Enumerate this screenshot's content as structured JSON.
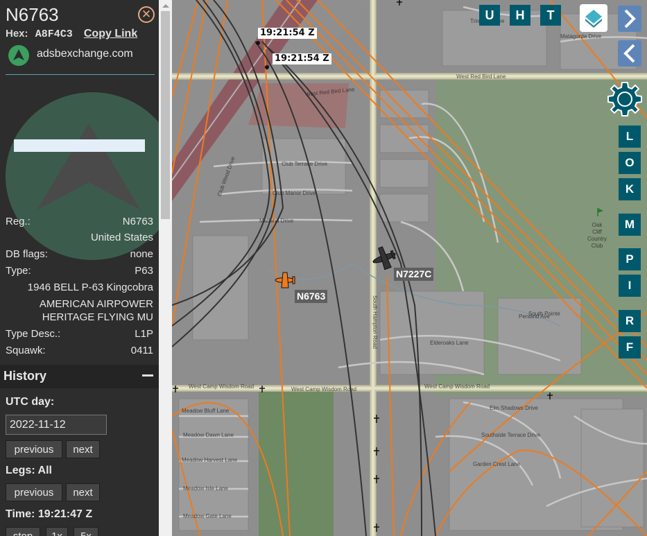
{
  "aircraft": {
    "title": "N6763",
    "hex_label": "Hex:",
    "hex_value": "A8F4C3",
    "copy_link": "Copy Link",
    "source": "adsbexchange.com",
    "reg_label": "Reg.:",
    "reg_value": "N6763",
    "country": "United States",
    "dbflags_label": "DB flags:",
    "dbflags_value": "none",
    "type_label": "Type:",
    "type_value": "P63",
    "model": "1946 BELL P-63 Kingcobra",
    "owner_line1": "AMERICAN AIRPOWER",
    "owner_line2": "HERITAGE FLYING MU",
    "typedesc_label": "Type Desc.:",
    "typedesc_value": "L1P",
    "squawk_label": "Squawk:",
    "squawk_value": "0411"
  },
  "history": {
    "header": "History",
    "utc_day_label": "UTC day:",
    "utc_day_value": "2022-11-12",
    "prev_label": "previous",
    "next_label": "next",
    "legs_label": "Legs: All",
    "legs_prev": "previous",
    "legs_next": "next",
    "time_label": "Time: 19:21:47 Z",
    "stop_label": "stop",
    "speed1_label": "1x",
    "speed5_label": "5x"
  },
  "map": {
    "timestamps": [
      "19:21:54 Z",
      "19:21:54 Z"
    ],
    "aircraft_labels": [
      "N6763",
      "N7227C"
    ],
    "top_buttons": [
      "U",
      "H",
      "T"
    ],
    "side_buttons": [
      "L",
      "O",
      "K",
      "M",
      "P",
      "I",
      "R",
      "F"
    ],
    "road_labels": {
      "west_red_bird_lane_1": "West Red Bird Lane",
      "west_red_bird_lane_2": "West Red Bird Lane",
      "club_terrace": "Club Terrace Drive",
      "club_manor": "Club Manor Drive",
      "club_wood": "Club Wood Drive",
      "matland": "Matland Drive",
      "west_camp_wisdom_1": "West Camp Wisdom Road",
      "west_camp_wisdom_2": "West Camp Wisdom Road",
      "west_camp_wisdom_3": "West Camp Wisdom Road",
      "south_hampton": "South Hampton Road",
      "meadow_bluff": "Meadow Bluff Lane",
      "meadow_dawn": "Meadow Dawn Lane",
      "meadow_harvest": "Meadow Harvest Lane",
      "meadow_isle": "Meadow Isle Lane",
      "meadow_gate": "Meadow Gate Lane",
      "elm_shadows": "Elm Shadows Drive",
      "southside_terrace": "Southside Terrace Drive",
      "garden_crest": "Garden Crest Lane",
      "oak_cliff": "Oak Cliff Country Club",
      "trinidad": "Trinidad Drive",
      "matagorda": "Matagorda Drive",
      "elderoaks": "Elderoaks Lane",
      "tarrant_rd": "Penland Ave",
      "south_pointe": "South Pointe"
    }
  }
}
